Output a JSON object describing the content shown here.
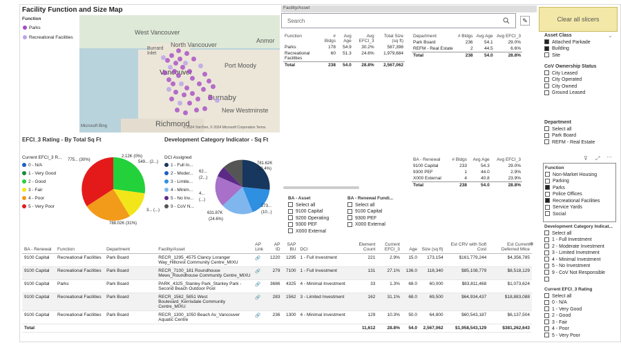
{
  "map_section": {
    "title": "Facility Function and Size Map",
    "legend_title": "Function",
    "legend": [
      {
        "label": "Parks",
        "color": "#a64cc4"
      },
      {
        "label": "Recreational Facilities",
        "color": "#b9a3e6"
      }
    ],
    "labels": {
      "west_van": "West Vancouver",
      "north_van": "North Vancouver",
      "burrard": "Burrard\nInlet",
      "port_moody": "Port Moody",
      "anmore": "Anmor",
      "burnaby": "Burnaby",
      "new_west": "New Westminste",
      "richmond": "Richmond",
      "vancouver": "Vancouver"
    },
    "attribution": "© 2024 TomTom, © 2024 Microsoft Corporation  Terms",
    "bing": "Microsoft Bing"
  },
  "search": {
    "header": "Facility/Asset",
    "placeholder": "Search"
  },
  "clear_button": "Clear all slicers",
  "function_table": {
    "headers": [
      "Function",
      "# Bldgs",
      "Avg Age",
      "Avg EFCI_3",
      "Total Size (sq ft)"
    ],
    "rows": [
      [
        "Parks",
        "178",
        "54.9",
        "30.2%",
        "587,398"
      ],
      [
        "Recreational Facilities",
        "60",
        "51.3",
        "24.6%",
        "1,979,684"
      ]
    ],
    "total": [
      "Total",
      "238",
      "54.0",
      "28.8%",
      "2,567,062"
    ]
  },
  "department_table": {
    "headers": [
      "Department",
      "# Bldgs",
      "Avg Age",
      "Avg EFCI_3"
    ],
    "rows": [
      [
        "Park Board",
        "236",
        "54.1",
        "29.0%"
      ],
      [
        "REFM - Real Estate",
        "2",
        "44.5",
        "6.6%"
      ]
    ],
    "total": [
      "Total",
      "238",
      "54.0",
      "28.8%"
    ]
  },
  "renewal_table": {
    "headers": [
      "BA - Renewal",
      "# Bldgs",
      "Avg Age",
      "Avg EFCI_3"
    ],
    "rows": [
      [
        "9100 Capital",
        "233",
        "54.3",
        "29.0%"
      ],
      [
        "9300 PEF",
        "1",
        "44.0",
        "2.9%"
      ],
      [
        "X000 External",
        "4",
        "40.8",
        "23.9%"
      ]
    ],
    "total": [
      "Total",
      "238",
      "54.0",
      "28.8%"
    ]
  },
  "efci_pie": {
    "title": "EFCI_3 Rating - By Total Sq Ft",
    "legend_title": "Current EFCI_3 R...",
    "legend": [
      {
        "label": "0 - N/A",
        "color": "#1f5fbf"
      },
      {
        "label": "1 - Very Good",
        "color": "#1a8a3a"
      },
      {
        "label": "2 - Good",
        "color": "#23d13a"
      },
      {
        "label": "3 - Fair",
        "color": "#f2e61a"
      },
      {
        "label": "4 - Poor",
        "color": "#f29a1a"
      },
      {
        "label": "5 - Very Poor",
        "color": "#e41a1a"
      }
    ],
    "labels": {
      "a": "775... (30%)",
      "b": "2.12K (0%)",
      "c": "549... (2...)",
      "d": "3... (...)",
      "e": "788.02K (31%)"
    }
  },
  "dci_pie": {
    "title": "Development Category Indicator - Sq Ft",
    "legend_title": "DCI Assigned",
    "legend": [
      {
        "label": "1 - Full In...",
        "color": "#17375e"
      },
      {
        "label": "2 - Moder...",
        "color": "#1f5fbf"
      },
      {
        "label": "3 - Limite...",
        "color": "#2f8fe0"
      },
      {
        "label": "4 - Minim...",
        "color": "#7fb6ee"
      },
      {
        "label": "5 - No Inv...",
        "color": "#5b2a86"
      },
      {
        "label": "9 - CoV N...",
        "color": "#555555"
      }
    ],
    "labels": {
      "a": "781.62K",
      "a2": "(30.4%)",
      "b": "62...",
      "b2": "(2...)",
      "c": "4...",
      "c2": "(...)",
      "d": "273...",
      "d2": "(10...)",
      "e": "631.87K",
      "e2": "(24.6%)"
    }
  },
  "ba_asset": {
    "title": "BA - Asset",
    "items": [
      "Select all",
      "9100 Capital",
      "9200 Operating",
      "9300 PEF",
      "X000 External"
    ]
  },
  "ba_renewal": {
    "title": "BA - Renewal Fundi...",
    "items": [
      "Select all",
      "9100 Capital",
      "9300 PEF",
      "X000 External"
    ]
  },
  "asset_class": {
    "title": "Asset Class",
    "items": [
      {
        "label": "Attached Parkade",
        "checked": true
      },
      {
        "label": "Building",
        "checked": true
      },
      {
        "label": "Site",
        "checked": false
      }
    ]
  },
  "ownership": {
    "title": "CoV Ownership Status",
    "items": [
      "City Leased",
      "City Operated",
      "City Owned",
      "Ground Leased"
    ]
  },
  "department_slicer": {
    "title": "Department",
    "items": [
      "Select all",
      "Park Board",
      "REFM - Real Estate"
    ]
  },
  "function_slicer": {
    "title": "Function",
    "partial": "Non-Market Housing",
    "items": [
      {
        "label": "Non-Market Housing",
        "checked": false
      },
      {
        "label": "Parking",
        "checked": false
      },
      {
        "label": "Parks",
        "checked": true
      },
      {
        "label": "Police Offices",
        "checked": false
      },
      {
        "label": "Recreational Facilities",
        "checked": true
      },
      {
        "label": "Service Yards",
        "checked": false
      },
      {
        "label": "Social",
        "checked": false
      }
    ]
  },
  "dci_slicer": {
    "title": "Development Category Indicat...",
    "items": [
      "Select all",
      "1 - Full Investment",
      "2 - Moderate Investment",
      "3 - Limited Investment",
      "4 - Minimal Investment",
      "5 - No Investment",
      "9 - CoV Not Responsible"
    ]
  },
  "efci_slicer": {
    "title": "Current EFCI_3 Rating",
    "items": [
      "Select all",
      "0 - N/A",
      "1 - Very Good",
      "2 - Good",
      "3 - Fair",
      "4 - Poor",
      "5 - Very Poor"
    ]
  },
  "bottom_table": {
    "headers": [
      "BA - Renewal",
      "Function",
      "Department",
      "Facility/Asset",
      "AP Link",
      "AP ID",
      "SAP BU",
      "DCI",
      "Element Count",
      "Current EFCI_3",
      "Age",
      "Size (sq ft)",
      "Est CRV with Soft Cost",
      "Est Current Deferred Mtce"
    ],
    "rows": [
      [
        "9100 Capital",
        "Recreational Facilities",
        "Park Board",
        "RECR_1295_4575 Clancy Loranger Way_Hillcrest Community Centre_MIXU",
        "🔗",
        "1220",
        "1295",
        "1 - Full Investment",
        "221",
        "2.9%",
        "15.0",
        "173,154",
        "$161,779,244",
        "$4,356,785"
      ],
      [
        "9100 Capital",
        "Recreational Facilities",
        "Park Board",
        "RECR_7100_181 Roundhouse Mews_Roundhouse Community Centre_MIXU",
        "🔗",
        "279",
        "7100",
        "1 - Full Investment",
        "131",
        "27.1%",
        "136.0",
        "118,340",
        "$85,108,779",
        "$8,518,129"
      ],
      [
        "9100 Capital",
        "Parks",
        "Park Board",
        "PARK_4325_Stanley Park_Stanley Park - Second Beach Outdoor Pool",
        "🔗",
        "3686",
        "4325",
        "4 - Minimal Investment",
        "33",
        "1.3%",
        "68.0",
        "60,000",
        "$83,811,468",
        "$1,073,624"
      ],
      [
        "9100 Capital",
        "Recreational Facilities",
        "Park Board",
        "RECR_1562_5851 West Boulevard_Kerrisdale Community Centre_MIXU",
        "🔗",
        "283",
        "1562",
        "3 - Limited Investment",
        "162",
        "31.1%",
        "68.0",
        "69,500",
        "$64,934,437",
        "$18,883,088"
      ],
      [
        "9100 Capital",
        "Recreational Facilities",
        "Park Board",
        "RECR_1300_1050 Beach Av_Vancouver Aquatic Centre",
        "🔗",
        "236",
        "1300",
        "4 - Minimal Investment",
        "129",
        "10.3%",
        "50.0",
        "64,800",
        "$60,543,187",
        "$6,137,504"
      ]
    ],
    "total": [
      "Total",
      "",
      "",
      "",
      "",
      "",
      "",
      "",
      "11,612",
      "28.8%",
      "54.0",
      "2,567,062",
      "$1,958,543,129",
      "$381,262,643"
    ]
  },
  "icons": [
    "search-icon",
    "eraser-icon",
    "filter-icon",
    "expand-icon",
    "more-icon",
    "chevron-down-icon",
    "link-icon"
  ]
}
